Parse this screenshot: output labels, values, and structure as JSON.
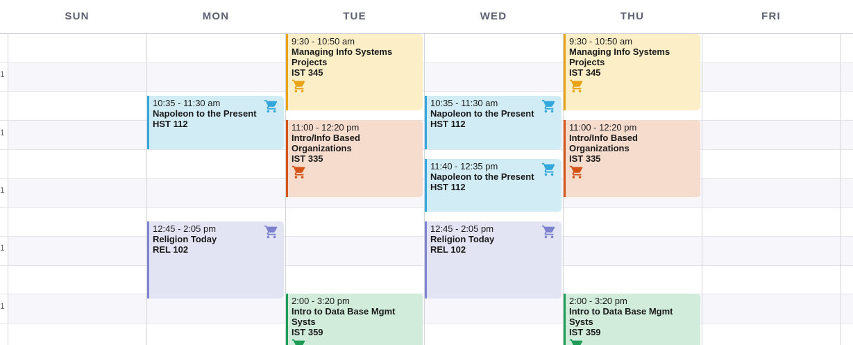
{
  "colors": {
    "yellow_bg": "#fcefc8",
    "yellow_border": "#e8a316",
    "yellow_cart": "#e8a316",
    "blue_bg": "#d2ecf6",
    "blue_border": "#33a7db",
    "blue_cart": "#33a7db",
    "orange_bg": "#f6dccd",
    "orange_border": "#d4551a",
    "orange_cart": "#d4551a",
    "purple_bg": "#e2e4f3",
    "purple_border": "#7d83cf",
    "purple_cart": "#7d83cf",
    "green_bg": "#d2ecdc",
    "green_border": "#1e9b56",
    "green_cart": "#1e9b56"
  },
  "days": [
    "SUN",
    "MON",
    "TUE",
    "WED",
    "THU",
    "FRI"
  ],
  "time_ticks": [
    "1",
    "1",
    "1",
    "1",
    "1"
  ],
  "events": [
    {
      "id": "mon-napoleon",
      "time": "10:35 - 11:30 am",
      "title": "Napoleon to the Present",
      "code": "HST 112",
      "color": "blue",
      "cart_icon": "cart-icon"
    },
    {
      "id": "mon-religion",
      "time": "12:45 - 2:05 pm",
      "title": "Religion Today",
      "code": "REL 102",
      "color": "purple",
      "cart_icon": "cart-icon"
    },
    {
      "id": "tue-managing",
      "time": "9:30 - 10:50 am",
      "title": "Managing Info Systems Projects",
      "code": "IST 345",
      "color": "yellow",
      "cart_icon": "cart-icon"
    },
    {
      "id": "tue-intro-info",
      "time": "11:00 - 12:20 pm",
      "title": "Intro/Info Based Organizations",
      "code": "IST 335",
      "color": "orange",
      "cart_icon": "cart-icon"
    },
    {
      "id": "tue-database",
      "time": "2:00 - 3:20 pm",
      "title": "Intro to Data Base Mgmt Systs",
      "code": "IST 359",
      "color": "green",
      "cart_icon": "cart-icon"
    },
    {
      "id": "wed-napoleon-1",
      "time": "10:35 - 11:30 am",
      "title": "Napoleon to the Present",
      "code": "HST 112",
      "color": "blue",
      "cart_icon": "cart-icon"
    },
    {
      "id": "wed-napoleon-2",
      "time": "11:40 - 12:35 pm",
      "title": "Napoleon to the Present",
      "code": "HST 112",
      "color": "blue",
      "cart_icon": "cart-icon"
    },
    {
      "id": "wed-religion",
      "time": "12:45 - 2:05 pm",
      "title": "Religion Today",
      "code": "REL 102",
      "color": "purple",
      "cart_icon": "cart-icon"
    },
    {
      "id": "thu-managing",
      "time": "9:30 - 10:50 am",
      "title": "Managing Info Systems Projects",
      "code": "IST 345",
      "color": "yellow",
      "cart_icon": "cart-icon"
    },
    {
      "id": "thu-intro-info",
      "time": "11:00 - 12:20 pm",
      "title": "Intro/Info Based Organizations",
      "code": "IST 335",
      "color": "orange",
      "cart_icon": "cart-icon"
    },
    {
      "id": "thu-database",
      "time": "2:00 - 3:20 pm",
      "title": "Intro to Data Base Mgmt Systs",
      "code": "IST 359",
      "color": "green",
      "cart_icon": "cart-icon"
    }
  ]
}
